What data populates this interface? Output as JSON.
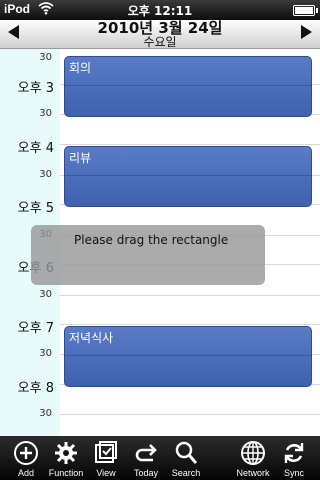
{
  "status_bar": {
    "device": "iPod",
    "time": "오후 12:11"
  },
  "nav": {
    "date": "2010년 3월 24일",
    "weekday": "수요일"
  },
  "schedule": {
    "hours": [
      {
        "label": "오후 3",
        "half": "30"
      },
      {
        "label": "오후 4",
        "half": "30"
      },
      {
        "label": "오후 5",
        "half": "30"
      },
      {
        "label": "오후 6",
        "half": "30"
      },
      {
        "label": "오후 7",
        "half": "30"
      },
      {
        "label": "오후 8",
        "half": "30"
      }
    ],
    "top_half": "30",
    "events": [
      {
        "title": "회의"
      },
      {
        "title": "리뷰"
      },
      {
        "title": "저녁식사"
      }
    ]
  },
  "hint": {
    "text": "Please drag the rectangle"
  },
  "toolbar": {
    "items": [
      {
        "label": "Add",
        "icon": "add-icon"
      },
      {
        "label": "Function",
        "icon": "gear-icon"
      },
      {
        "label": "View",
        "icon": "view-icon"
      },
      {
        "label": "Today",
        "icon": "today-arrow-icon"
      },
      {
        "label": "Search",
        "icon": "search-icon"
      },
      {
        "label": "Network",
        "icon": "globe-icon"
      },
      {
        "label": "Sync",
        "icon": "sync-icon"
      }
    ]
  }
}
